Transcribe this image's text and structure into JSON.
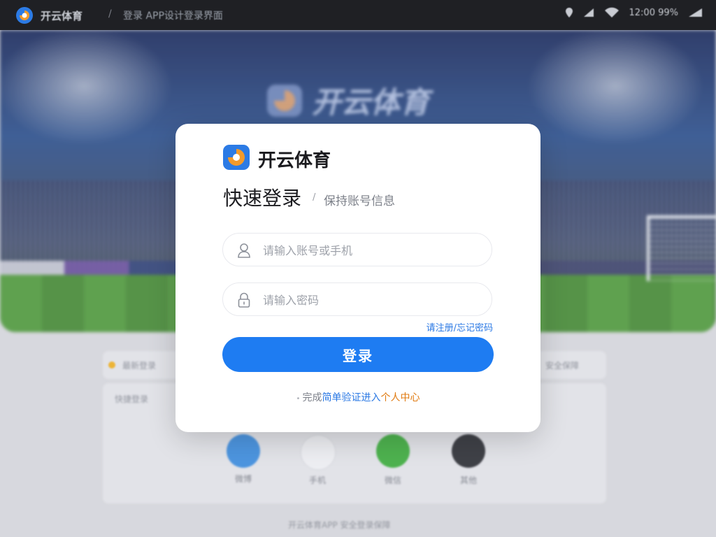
{
  "topbar": {
    "app_title": "开云体育",
    "separator": "/",
    "page_subtitle": "登录 APP设计登录界面",
    "status_text": "12:00 99%"
  },
  "banner": {
    "brand_name": "开云体育"
  },
  "background": {
    "notice_left": "最新登录",
    "notice_right": "安全保障",
    "panel_title": "快捷登录",
    "quick_login": [
      {
        "label": "微博",
        "icon": "weibo-icon",
        "color": "#3b8de0"
      },
      {
        "label": "手机",
        "icon": "phone-icon",
        "color": "#f1f2f5"
      },
      {
        "label": "微信",
        "icon": "wechat-icon",
        "color": "#3cae3c"
      },
      {
        "label": "其他",
        "icon": "other-icon",
        "color": "#2b2d33"
      }
    ],
    "footer_text": "开云体育APP 安全登录保障"
  },
  "modal": {
    "brand_name": "开云体育",
    "title": "快速登录",
    "slash": "/",
    "subtitle": "保持账号信息",
    "username_placeholder": "请输入账号或手机",
    "password_placeholder": "请输入密码",
    "forgot_link": "请注册/忘记密码",
    "login_button": "登录",
    "bottom_prefix": "完成",
    "bottom_link_blue": "简单验证进入",
    "bottom_link_orange": "个人中心"
  },
  "colors": {
    "accent": "#1e7cf2",
    "link_orange": "#e07a10",
    "topbar_bg": "#1f2024"
  }
}
